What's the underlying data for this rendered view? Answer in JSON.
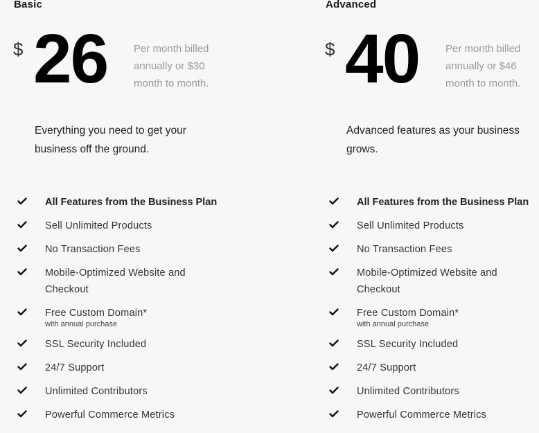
{
  "plans": [
    {
      "name": "Basic",
      "currency": "$",
      "price": "26",
      "billing": "Per month billed annually or $30 month to month.",
      "tagline": "Everything you need to get your business off the ground.",
      "features": [
        {
          "label": "All Features from the Business Plan",
          "note": null,
          "icon": "check-icon"
        },
        {
          "label": "Sell Unlimited Products",
          "note": null,
          "icon": "check-icon"
        },
        {
          "label": "No Transaction Fees",
          "note": null,
          "icon": "check-icon"
        },
        {
          "label": "Mobile-Optimized Website and Checkout",
          "note": null,
          "icon": "check-icon"
        },
        {
          "label": "Free Custom Domain*",
          "note": "with annual purchase",
          "icon": "check-icon"
        },
        {
          "label": "SSL Security Included",
          "note": null,
          "icon": "check-icon"
        },
        {
          "label": "24/7 Support",
          "note": null,
          "icon": "check-icon"
        },
        {
          "label": "Unlimited Contributors",
          "note": null,
          "icon": "check-icon"
        },
        {
          "label": "Powerful Commerce Metrics",
          "note": null,
          "icon": "check-icon"
        }
      ]
    },
    {
      "name": "Advanced",
      "currency": "$",
      "price": "40",
      "billing": "Per month billed annually or $46 month to month.",
      "tagline": "Advanced features as your business grows.",
      "features": [
        {
          "label": "All Features from the Business Plan",
          "note": null,
          "icon": "check-icon"
        },
        {
          "label": "Sell Unlimited Products",
          "note": null,
          "icon": "check-icon"
        },
        {
          "label": "No Transaction Fees",
          "note": null,
          "icon": "check-icon"
        },
        {
          "label": "Mobile-Optimized Website and Checkout",
          "note": null,
          "icon": "check-icon"
        },
        {
          "label": "Free Custom Domain*",
          "note": "with annual purchase",
          "icon": "check-icon"
        },
        {
          "label": "SSL Security Included",
          "note": null,
          "icon": "check-icon"
        },
        {
          "label": "24/7 Support",
          "note": null,
          "icon": "check-icon"
        },
        {
          "label": "Unlimited Contributors",
          "note": null,
          "icon": "check-icon"
        },
        {
          "label": "Powerful Commerce Metrics",
          "note": null,
          "icon": "check-icon"
        }
      ]
    }
  ]
}
